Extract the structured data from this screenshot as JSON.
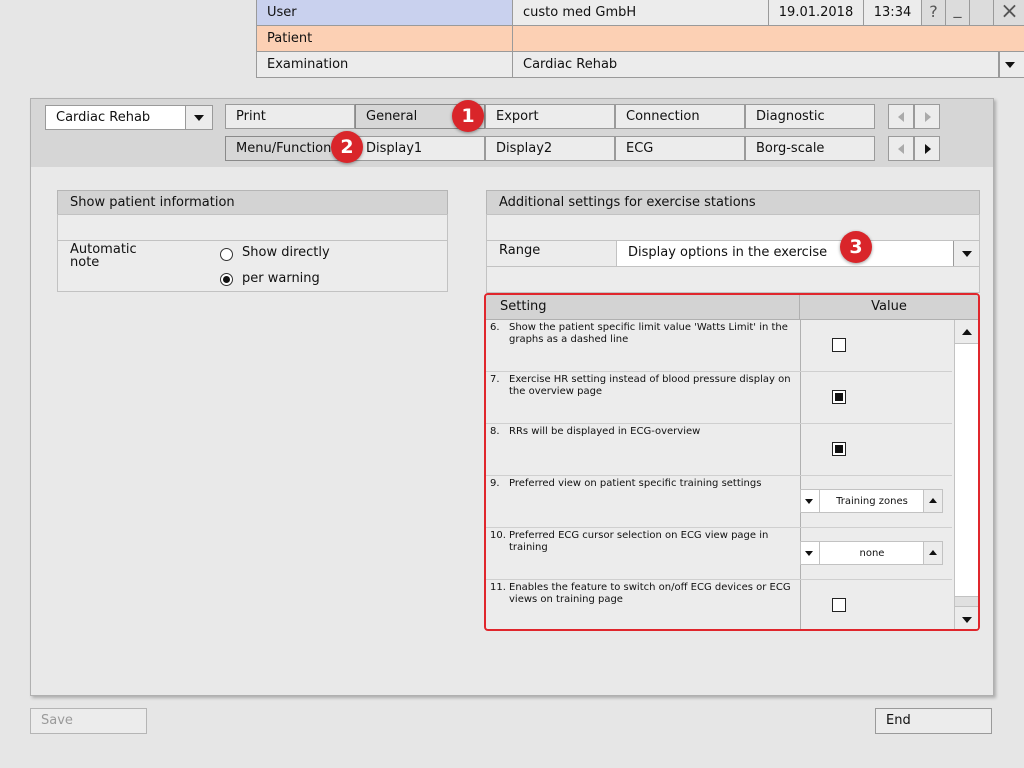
{
  "header": {
    "user_label": "User",
    "user_value": "custo med GmbH",
    "date": "19.01.2018",
    "time": "13:34",
    "help_glyph": "?",
    "minimize_glyph": "_",
    "close_glyph": "×",
    "patient_label": "Patient",
    "examination_label": "Examination",
    "examination_value": "Cardiac Rehab",
    "patient_color": "#fcd0b4",
    "user_color": "#c9d1ee"
  },
  "module_select": "Cardiac Rehab",
  "tabs_row1": [
    "Print",
    "General",
    "Export",
    "Connection",
    "Diagnostic"
  ],
  "tabs_row2": [
    "Menu/Functions",
    "Display1",
    "Display2",
    "ECG",
    "Borg-scale"
  ],
  "badges": [
    "1",
    "2",
    "3"
  ],
  "patient_info": {
    "title": "Show patient information",
    "automatic_note_label": "Automatic note",
    "options": [
      "Show directly",
      "per warning"
    ],
    "selected": "per warning"
  },
  "exercise": {
    "title": "Additional settings for exercise stations",
    "range_label": "Range",
    "range_value": "Display options in the exercise",
    "setting_header": "Setting",
    "value_header": "Value",
    "rows": [
      {
        "num": "6.",
        "text": "Show the patient specific limit value 'Watts Limit' in the graphs as a dashed line",
        "type": "checkbox",
        "checked": false
      },
      {
        "num": "7.",
        "text": "Exercise HR setting instead of blood pressure display on the overview page",
        "type": "checkbox",
        "checked": true
      },
      {
        "num": "8.",
        "text": "RRs will be displayed in ECG-overview",
        "type": "checkbox",
        "checked": true
      },
      {
        "num": "9.",
        "text": "Preferred view on patient specific training settings",
        "type": "spinner",
        "value": "Training zones"
      },
      {
        "num": "10.",
        "text": "Preferred ECG cursor selection on ECG view page in training",
        "type": "spinner",
        "value": "none"
      },
      {
        "num": "11.",
        "text": "Enables the feature to switch on/off ECG devices or ECG views on training page",
        "type": "checkbox",
        "checked": false
      }
    ]
  },
  "footer": {
    "save_label": "Save",
    "end_label": "End"
  },
  "colors": {
    "highlight_border": "#e0262c",
    "badge": "#d9252a"
  }
}
